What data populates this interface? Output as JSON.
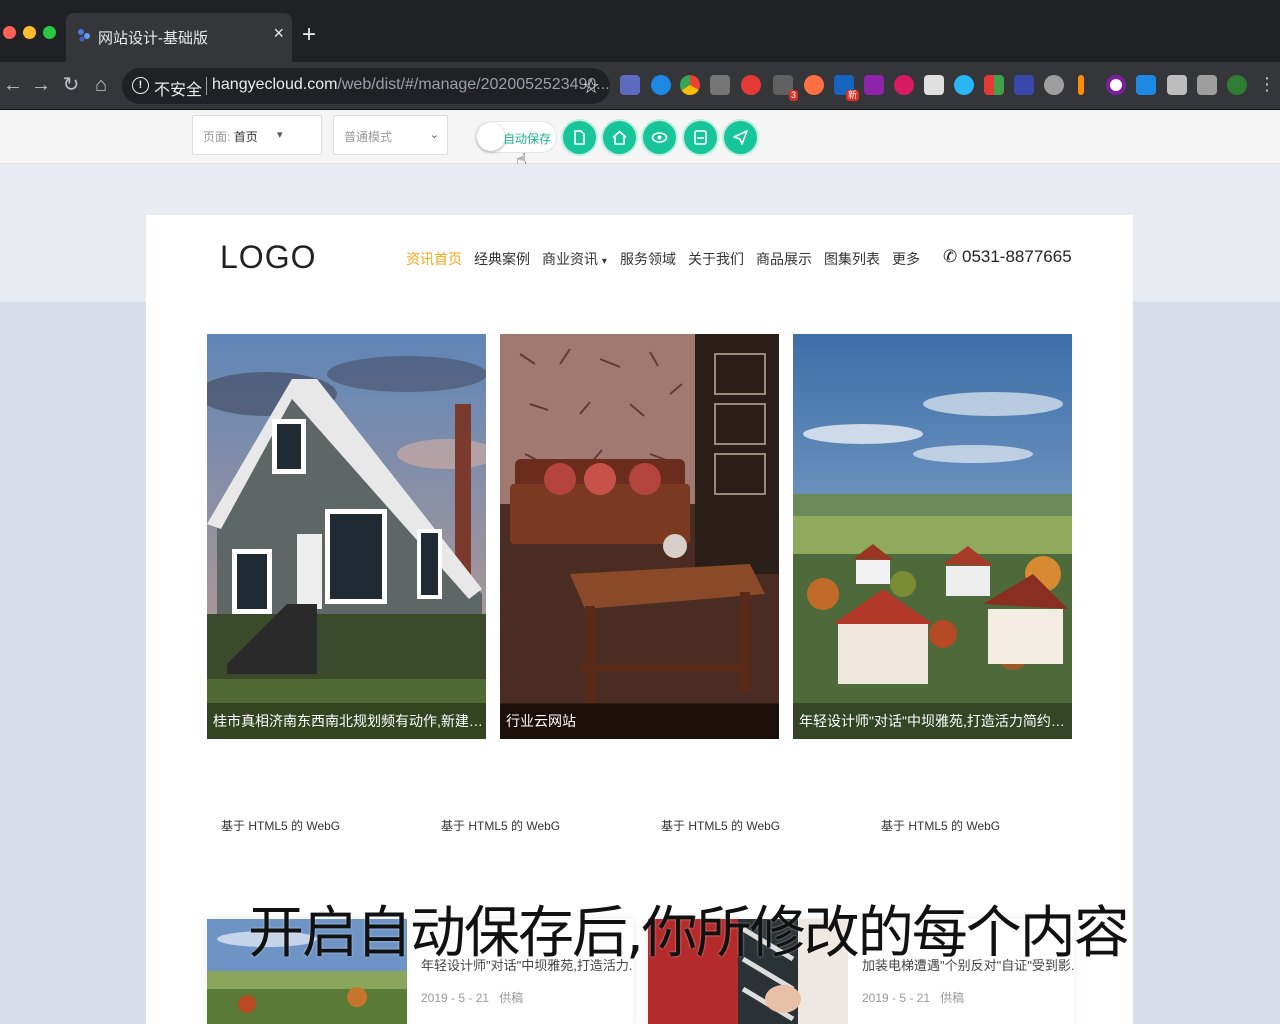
{
  "browser": {
    "tab_title": "网站设计-基础版",
    "tab_close": "×",
    "new_tab": "+",
    "security_label": "不安全",
    "url_host": "hangyecloud.com",
    "url_path": "/web/dist/#/manage/2020052523490...",
    "ext_badge_1": "3",
    "ext_badge_2": "新"
  },
  "editor": {
    "page_select_prefix": "页面:",
    "page_select_value": "首页",
    "mode_select_value": "普通模式",
    "autosave_label": "自动保存",
    "accent_color": "#18c59a"
  },
  "site": {
    "logo": "LOGO",
    "nav": [
      "资讯首页",
      "经典案例",
      "商业资讯",
      "服务领域",
      "关于我们",
      "商品展示",
      "图集列表",
      "更多"
    ],
    "nav_dropdown_mark": "▾",
    "active_color": "#f0a81c",
    "phone": "0531-8877665",
    "gallery": [
      {
        "caption": "桂市真相济南东西南北规划频有动作,新建多所学..."
      },
      {
        "caption": "行业云网站"
      },
      {
        "caption": "年轻设计师\"对话\"中坝雅苑,打造活力简约之家"
      }
    ],
    "subtitles": [
      "基于 HTML5 的 WebG",
      "基于 HTML5 的 WebG",
      "基于 HTML5 的 WebG",
      "基于 HTML5 的 WebG"
    ],
    "news": [
      {
        "title": "年轻设计师\"对话\"中坝雅苑,打造活力...",
        "date": "2019 - 5 - 21",
        "source": "供稿"
      },
      {
        "title": "加装电梯遭遇\"个别反对\"自证\"受到影...",
        "date": "2019 - 5 - 21",
        "source": "供稿"
      }
    ]
  },
  "overlay_caption": "开启自动保存后,你所修改的每个内容"
}
